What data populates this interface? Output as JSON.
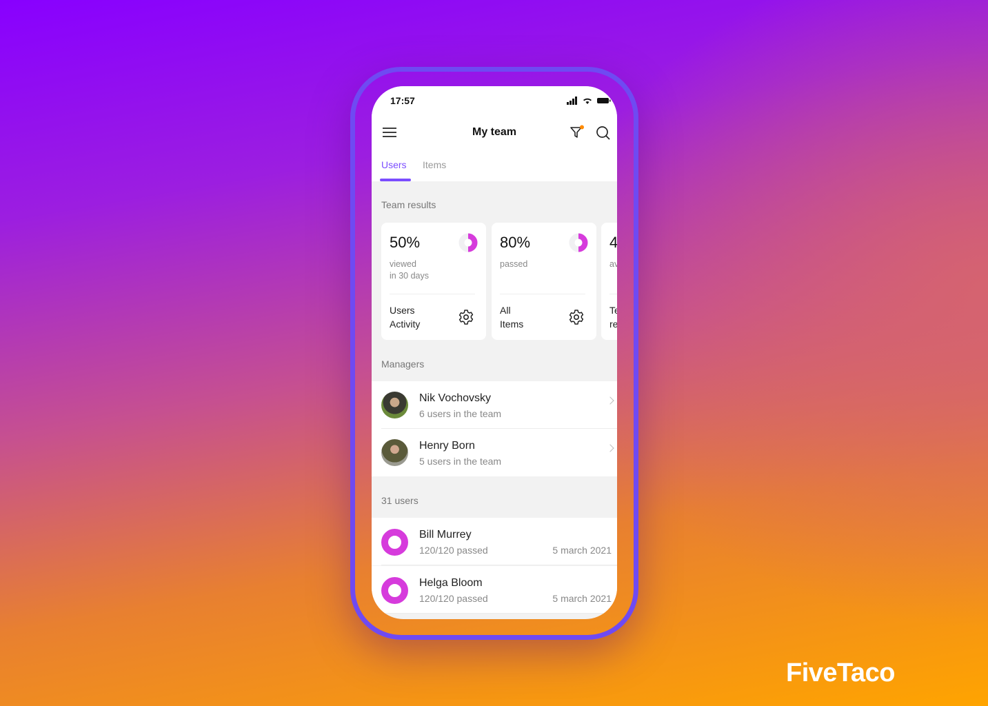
{
  "status_bar": {
    "time": "17:57"
  },
  "header": {
    "title": "My team",
    "menu_icon": "hamburger-icon",
    "filter_icon": "filter-icon",
    "search_icon": "search-icon"
  },
  "tabs": [
    {
      "label": "Users",
      "active": true
    },
    {
      "label": "Items",
      "active": false
    }
  ],
  "team_results": {
    "heading": "Team results",
    "cards": [
      {
        "value": "50%",
        "line1": "viewed",
        "line2": "in 30 days",
        "footer1": "Users",
        "footer2": "Activity",
        "progress": 0.5
      },
      {
        "value": "80%",
        "line1": "passed",
        "line2": "",
        "footer1": "All",
        "footer2": "Items",
        "progress": 0.5
      },
      {
        "value": "4",
        "line1": "av",
        "line2": "",
        "footer1": "Te",
        "footer2": "re"
      }
    ]
  },
  "managers": {
    "heading": "Managers",
    "items": [
      {
        "name": "Nik Vochovsky",
        "sub": "6 users in the team"
      },
      {
        "name": "Henry Born",
        "sub": "5 users in the team"
      }
    ]
  },
  "users": {
    "heading": "31 users",
    "items": [
      {
        "name": "Bill Murrey",
        "sub": "120/120 passed",
        "date": "5 march 2021"
      },
      {
        "name": "Helga Bloom",
        "sub": "120/120 passed",
        "date": "5 march 2021"
      }
    ]
  },
  "brand": {
    "logo": "FiveTaco",
    "accent": "#7b4dff",
    "ring": "#d63bdc",
    "filter_dot": "#ff8a00"
  }
}
